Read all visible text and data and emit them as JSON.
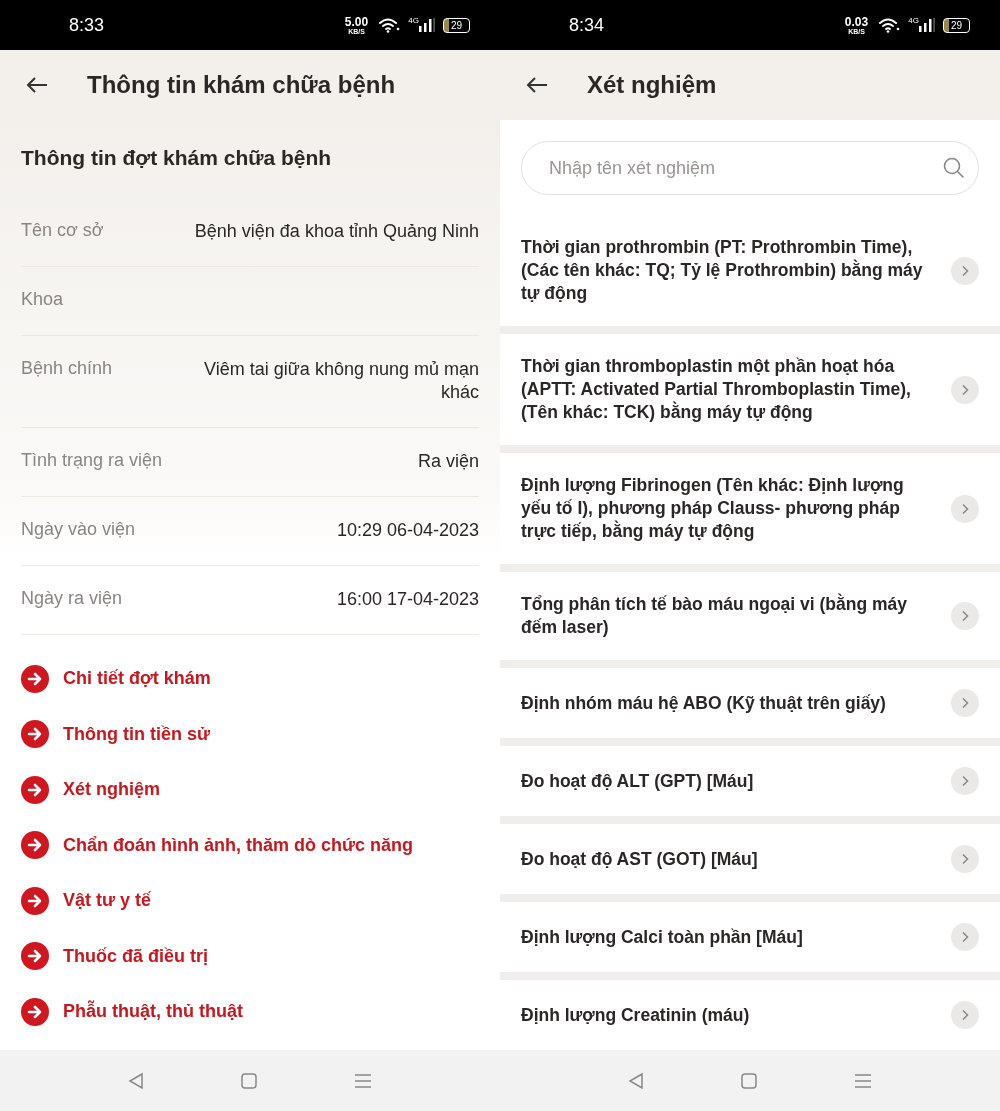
{
  "visit_screen": {
    "status_bar": {
      "time": "8:33",
      "speed": "5.00",
      "speed_unit": "KB/S",
      "network_type": "4G",
      "battery": "29"
    },
    "header": {
      "title": "Thông tin khám chữa bệnh"
    },
    "section_title": "Thông tin đợt khám chữa bệnh",
    "details": [
      {
        "label": "Tên cơ sở",
        "value": "Bệnh viện đa khoa tỉnh Quảng Ninh"
      },
      {
        "label": "Khoa"
      },
      {
        "label": "Bệnh chính",
        "value": "Viêm tai giữa không nung mủ mạn khác"
      },
      {
        "label": "Tình trạng ra viện",
        "value": "Ra viện"
      },
      {
        "label": "Ngày vào viện",
        "value": "10:29 06-04-2023"
      },
      {
        "label": "Ngày ra viện",
        "value": "16:00 17-04-2023"
      }
    ],
    "links": [
      "Chi tiết đợt khám",
      "Thông tin tiền sử",
      "Xét nghiệm",
      "Chẩn đoán hình ảnh, thăm dò chức năng",
      "Vật tư y tế",
      "Thuốc đã điều trị",
      "Phẫu thuật, thủ thuật"
    ]
  },
  "tests_screen": {
    "status_bar": {
      "time": "8:34",
      "speed": "0.03",
      "speed_unit": "KB/S",
      "network_type": "4G",
      "battery": "29"
    },
    "header": {
      "title": "Xét nghiệm"
    },
    "search": {
      "placeholder": "Nhập tên xét nghiệm"
    },
    "tests": [
      "Thời gian prothrombin (PT: Prothrombin Time), (Các tên khác: TQ; Tỷ lệ Prothrombin) bằng máy tự động",
      "Thời gian thromboplastin một phần hoạt hóa (APTT: Activated Partial Thromboplastin Time), (Tên khác: TCK) bằng máy tự động",
      "Định lượng Fibrinogen (Tên khác: Định lượng yếu tố I), phương pháp Clauss- phương pháp trực tiếp, bằng máy tự động",
      "Tổng phân tích tế bào máu ngoại vi (bằng máy đếm laser)",
      "Định nhóm máu hệ ABO (Kỹ thuật trên giấy)",
      "Đo hoạt độ ALT (GPT) [Máu]",
      "Đo hoạt độ AST (GOT) [Máu]",
      "Định lượng Calci toàn phần [Máu]",
      "Định lượng Creatinin (máu)"
    ]
  }
}
